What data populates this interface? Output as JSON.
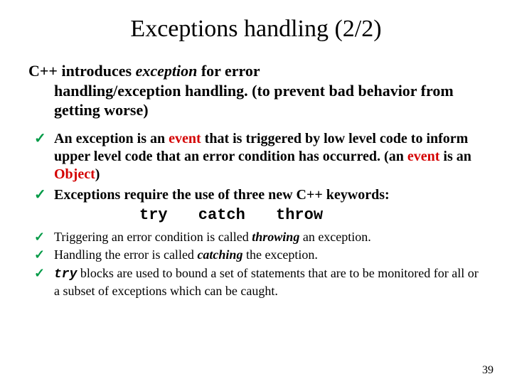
{
  "title": "Exceptions handling (2/2)",
  "lead": {
    "part1": "C++ introduces ",
    "em": "exception",
    "part2_a": " for error",
    "part2_b": "handling/exception handling.  (to prevent bad behavior from getting worse)"
  },
  "b1": {
    "item1": {
      "a": "An exception is an ",
      "event1": "event",
      "b": " that is triggered by low level code to inform upper level code that an error condition has occurred. (an ",
      "event2": "event",
      "c": " is an ",
      "object": "Object",
      "d": ")"
    },
    "item2": {
      "a": "Exceptions require the use of three new C",
      "plus": "++",
      "b": " keywords:",
      "kw": "try catch throw"
    }
  },
  "b2": {
    "item1": {
      "a": "Triggering an error condition is called ",
      "k": "throwing",
      "b": " an exception."
    },
    "item2": {
      "a": "Handling the error is called ",
      "k": "catching",
      "b": " the exception."
    },
    "item3": {
      "k": "try",
      "a": " blocks are used to bound a set of statements that are to be monitored for all or a subset of exceptions which can be caught."
    }
  },
  "page": "39"
}
